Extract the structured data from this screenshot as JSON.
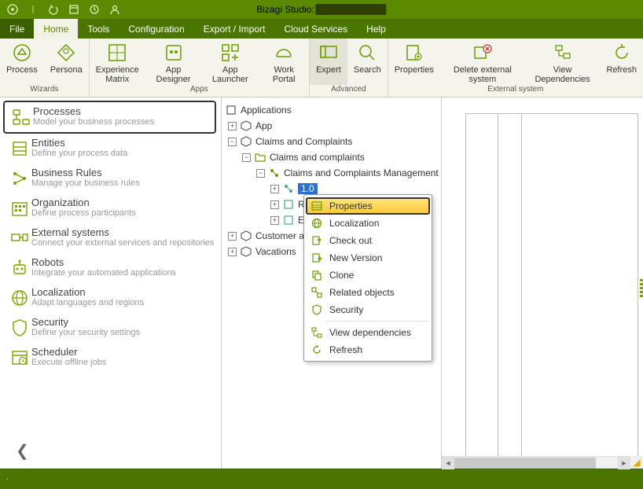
{
  "titlebar": {
    "app": "Bizagi Studio:"
  },
  "menu": {
    "file": "File",
    "home": "Home",
    "tools": "Tools",
    "configuration": "Configuration",
    "exportimport": "Export / Import",
    "cloud": "Cloud Services",
    "help": "Help"
  },
  "ribbon": {
    "wizards": {
      "label": "Wizards",
      "process": "Process",
      "persona": "Persona"
    },
    "apps": {
      "label": "Apps",
      "experience": "Experience\nMatrix",
      "designer": "App Designer",
      "launcher": "App Launcher",
      "portal": "Work Portal"
    },
    "advanced": {
      "label": "Advanced",
      "expert": "Expert",
      "search": "Search"
    },
    "external": {
      "label": "External system",
      "properties": "Properties",
      "delete": "Delete external system",
      "viewdeps": "View Dependencies",
      "refresh": "Refresh"
    }
  },
  "sidebar": {
    "items": [
      {
        "title": "Processes",
        "desc": "Model your business processes"
      },
      {
        "title": "Entities",
        "desc": "Define your process data"
      },
      {
        "title": "Business Rules",
        "desc": "Manage your business rules"
      },
      {
        "title": "Organization",
        "desc": "Define process participants"
      },
      {
        "title": "External systems",
        "desc": "Connect your external services and repositories"
      },
      {
        "title": "Robots",
        "desc": "Integrate your automated applications"
      },
      {
        "title": "Localization",
        "desc": "Adapt languages and regions"
      },
      {
        "title": "Security",
        "desc": "Define your security settings"
      },
      {
        "title": "Scheduler",
        "desc": "Execute offline jobs"
      }
    ]
  },
  "tree": {
    "root": "Applications",
    "app": "App",
    "claims": "Claims and Complaints",
    "claims_sub": "Claims and complaints",
    "mgmt": "Claims and Complaints Management",
    "version": "1.0",
    "reusable": "Reus",
    "embedded": "Embe",
    "customer": "Customer att",
    "vacations": "Vacations"
  },
  "contextmenu": {
    "properties": "Properties",
    "localization": "Localization",
    "checkout": "Check out",
    "newversion": "New Version",
    "clone": "Clone",
    "related": "Related objects",
    "security": "Security",
    "viewdeps": "View dependencies",
    "refresh": "Refresh"
  },
  "status": {
    "text": "."
  }
}
